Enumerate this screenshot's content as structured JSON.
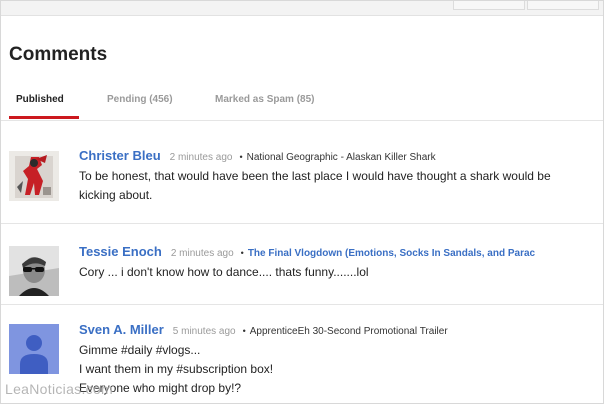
{
  "page": {
    "title": "Comments"
  },
  "tabs": [
    {
      "label": "Published",
      "active": true
    },
    {
      "label": "Pending (456)",
      "active": false
    },
    {
      "label": "Marked as Spam (85)",
      "active": false
    }
  ],
  "comments": [
    {
      "author": "Christer Bleu",
      "time": "2 minutes ago",
      "video": "National Geographic - Alaskan Killer Shark",
      "lines": [
        "To be honest, that would have been the last place I would have thought a shark would be",
        "kicking about."
      ]
    },
    {
      "author": "Tessie Enoch",
      "time": "2 minutes ago",
      "video": "The Final Vlogdown (Emotions, Socks In Sandals, and Parac",
      "lines": [
        "Cory ... i don't know how to dance.... thats funny.......lol"
      ]
    },
    {
      "author": "Sven A. Miller",
      "time": "5 minutes ago",
      "video": "ApprenticeEh 30-Second Promotional Trailer",
      "lines": [
        "Gimme #daily #vlogs...",
        "I want them in my #subscription box!",
        "Everyone who might drop by!?"
      ]
    }
  ],
  "watermark": "LeaNoticias.com",
  "colors": {
    "accent": "#cc181e",
    "link": "#3a6fc4",
    "default_avatar_bg": "#7f95e0"
  },
  "icons": {
    "separator": "•",
    "default_avatar": "person-silhouette-icon"
  }
}
